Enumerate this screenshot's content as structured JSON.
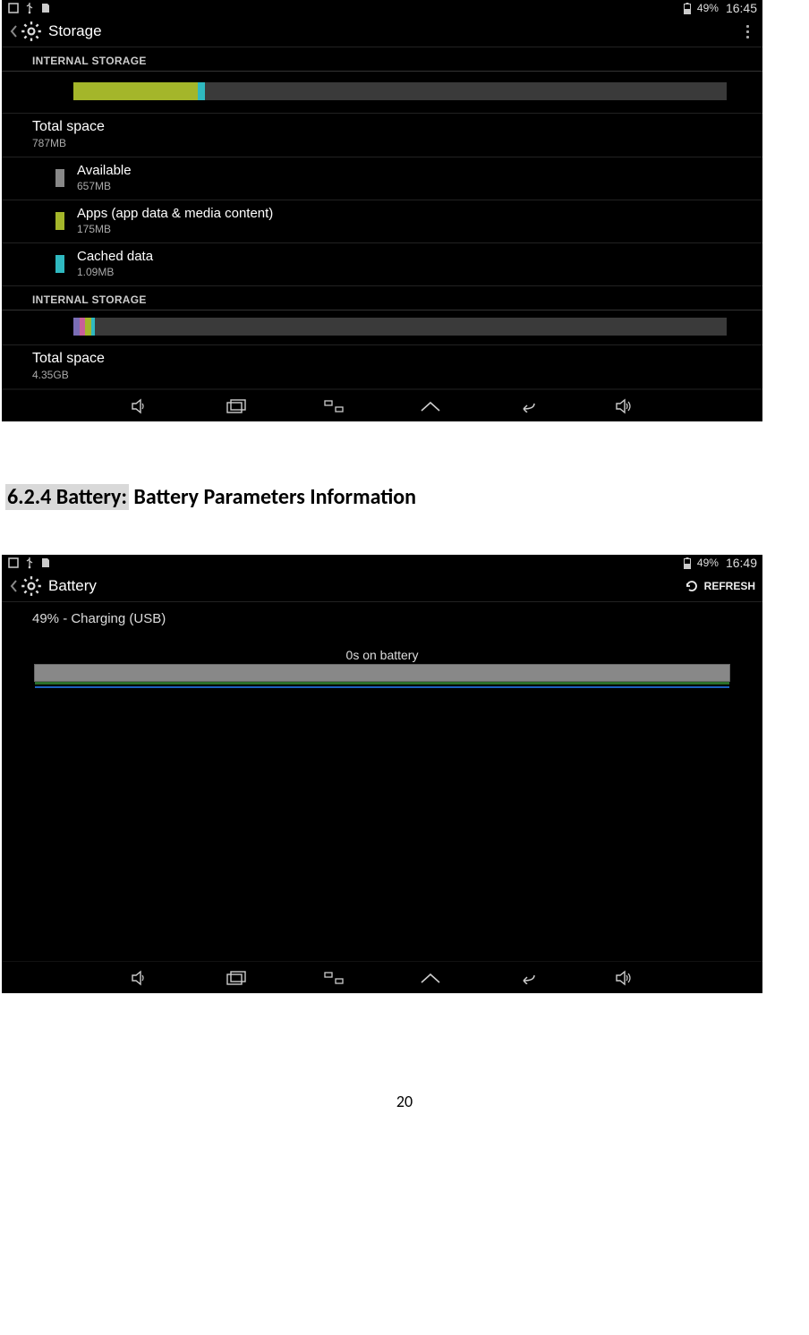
{
  "screenshot1": {
    "statusbar": {
      "battery": "49%",
      "time": "16:45"
    },
    "title": "Storage",
    "section1_label": "INTERNAL STORAGE",
    "bar1": {
      "segments": [
        {
          "color": "#a4b62a",
          "width_pct": 19
        },
        {
          "color": "#2fb9c0",
          "width_pct": 1.2
        }
      ]
    },
    "total1": {
      "label": "Total space",
      "value": "787MB"
    },
    "rows": [
      {
        "swatch": "#888888",
        "label": "Available",
        "value": "657MB"
      },
      {
        "swatch": "#a4b62a",
        "label": "Apps (app data & media content)",
        "value": "175MB"
      },
      {
        "swatch": "#2fb9c0",
        "label": "Cached data",
        "value": "1.09MB"
      }
    ],
    "section2_label": "INTERNAL STORAGE",
    "bar2": {
      "segments": [
        {
          "color": "#7a6db5",
          "width_pct": 0.9
        },
        {
          "color": "#c85f9a",
          "width_pct": 0.9
        },
        {
          "color": "#a4b62a",
          "width_pct": 0.9
        },
        {
          "color": "#2fb9c0",
          "width_pct": 0.6
        }
      ]
    },
    "total2": {
      "label": "Total space",
      "value": "4.35GB"
    }
  },
  "doc_heading": {
    "prefix": "6.2.4 Battery:",
    "rest": " Battery Parameters Information"
  },
  "screenshot2": {
    "statusbar": {
      "battery": "49%",
      "time": "16:49"
    },
    "title": "Battery",
    "refresh_label": "REFRESH",
    "status_text": "49% - Charging (USB)",
    "graph_label": "0s on battery"
  },
  "page_number": "20"
}
